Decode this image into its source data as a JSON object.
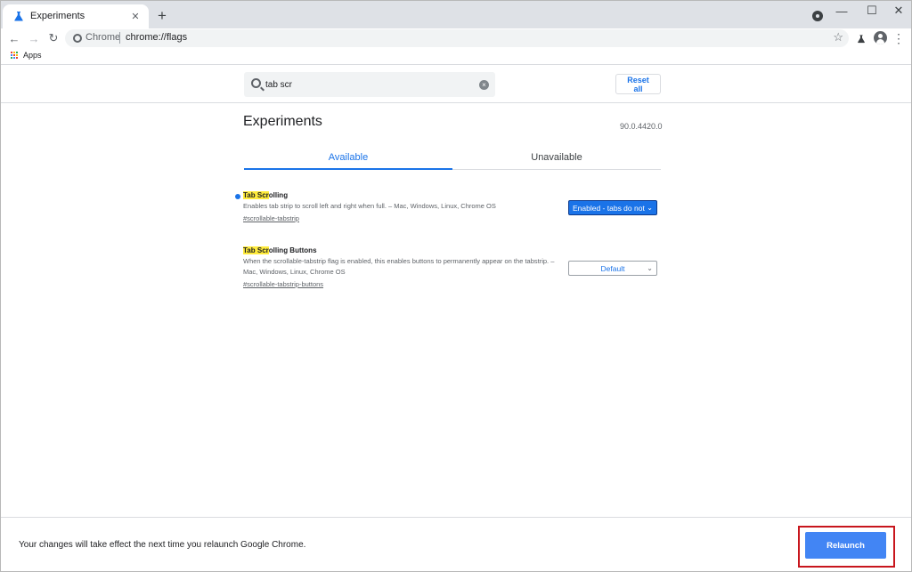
{
  "browser": {
    "tab": {
      "title": "Experiments",
      "close_glyph": "✕"
    },
    "new_tab_glyph": "+",
    "window_controls": {
      "minimize": "—",
      "maximize": "☐",
      "close": "✕"
    },
    "nav": {
      "back": "←",
      "forward": "→",
      "reload": "↻"
    },
    "omnibox": {
      "site_chip": "Chrome",
      "url": "chrome://flags",
      "star_glyph": "☆"
    },
    "menu_glyph": "⋮",
    "bookmarks": {
      "apps_label": "Apps"
    }
  },
  "flags_page": {
    "search": {
      "value": "tab scr",
      "clear_glyph": "×"
    },
    "reset_label": "Reset all",
    "title": "Experiments",
    "version": "90.0.4420.0",
    "tabs": [
      {
        "label": "Available",
        "active": true
      },
      {
        "label": "Unavailable",
        "active": false
      }
    ],
    "flags": [
      {
        "name_highlight": "Tab Scr",
        "name_rest": "olling",
        "description": "Enables tab strip to scroll left and right when full. – Mac, Windows, Linux, Chrome OS",
        "link": "#scrollable-tabstrip",
        "selected": "Enabled - tabs do not",
        "modified": true
      },
      {
        "name_highlight": "Tab Scr",
        "name_rest": "olling Buttons",
        "description": "When the scrollable-tabstrip flag is enabled, this enables buttons to permanently appear on the tabstrip. – Mac, Windows, Linux, Chrome OS",
        "link": "#scrollable-tabstrip-buttons",
        "selected": "Default",
        "modified": false
      }
    ]
  },
  "bottom_bar": {
    "message": "Your changes will take effect the next time you relaunch Google Chrome.",
    "relaunch_label": "Relaunch"
  },
  "colors": {
    "accent": "#1a73e8",
    "relaunch": "#4285f4",
    "highlight": "#ffeb3b",
    "annotation_frame": "#c8161d"
  }
}
